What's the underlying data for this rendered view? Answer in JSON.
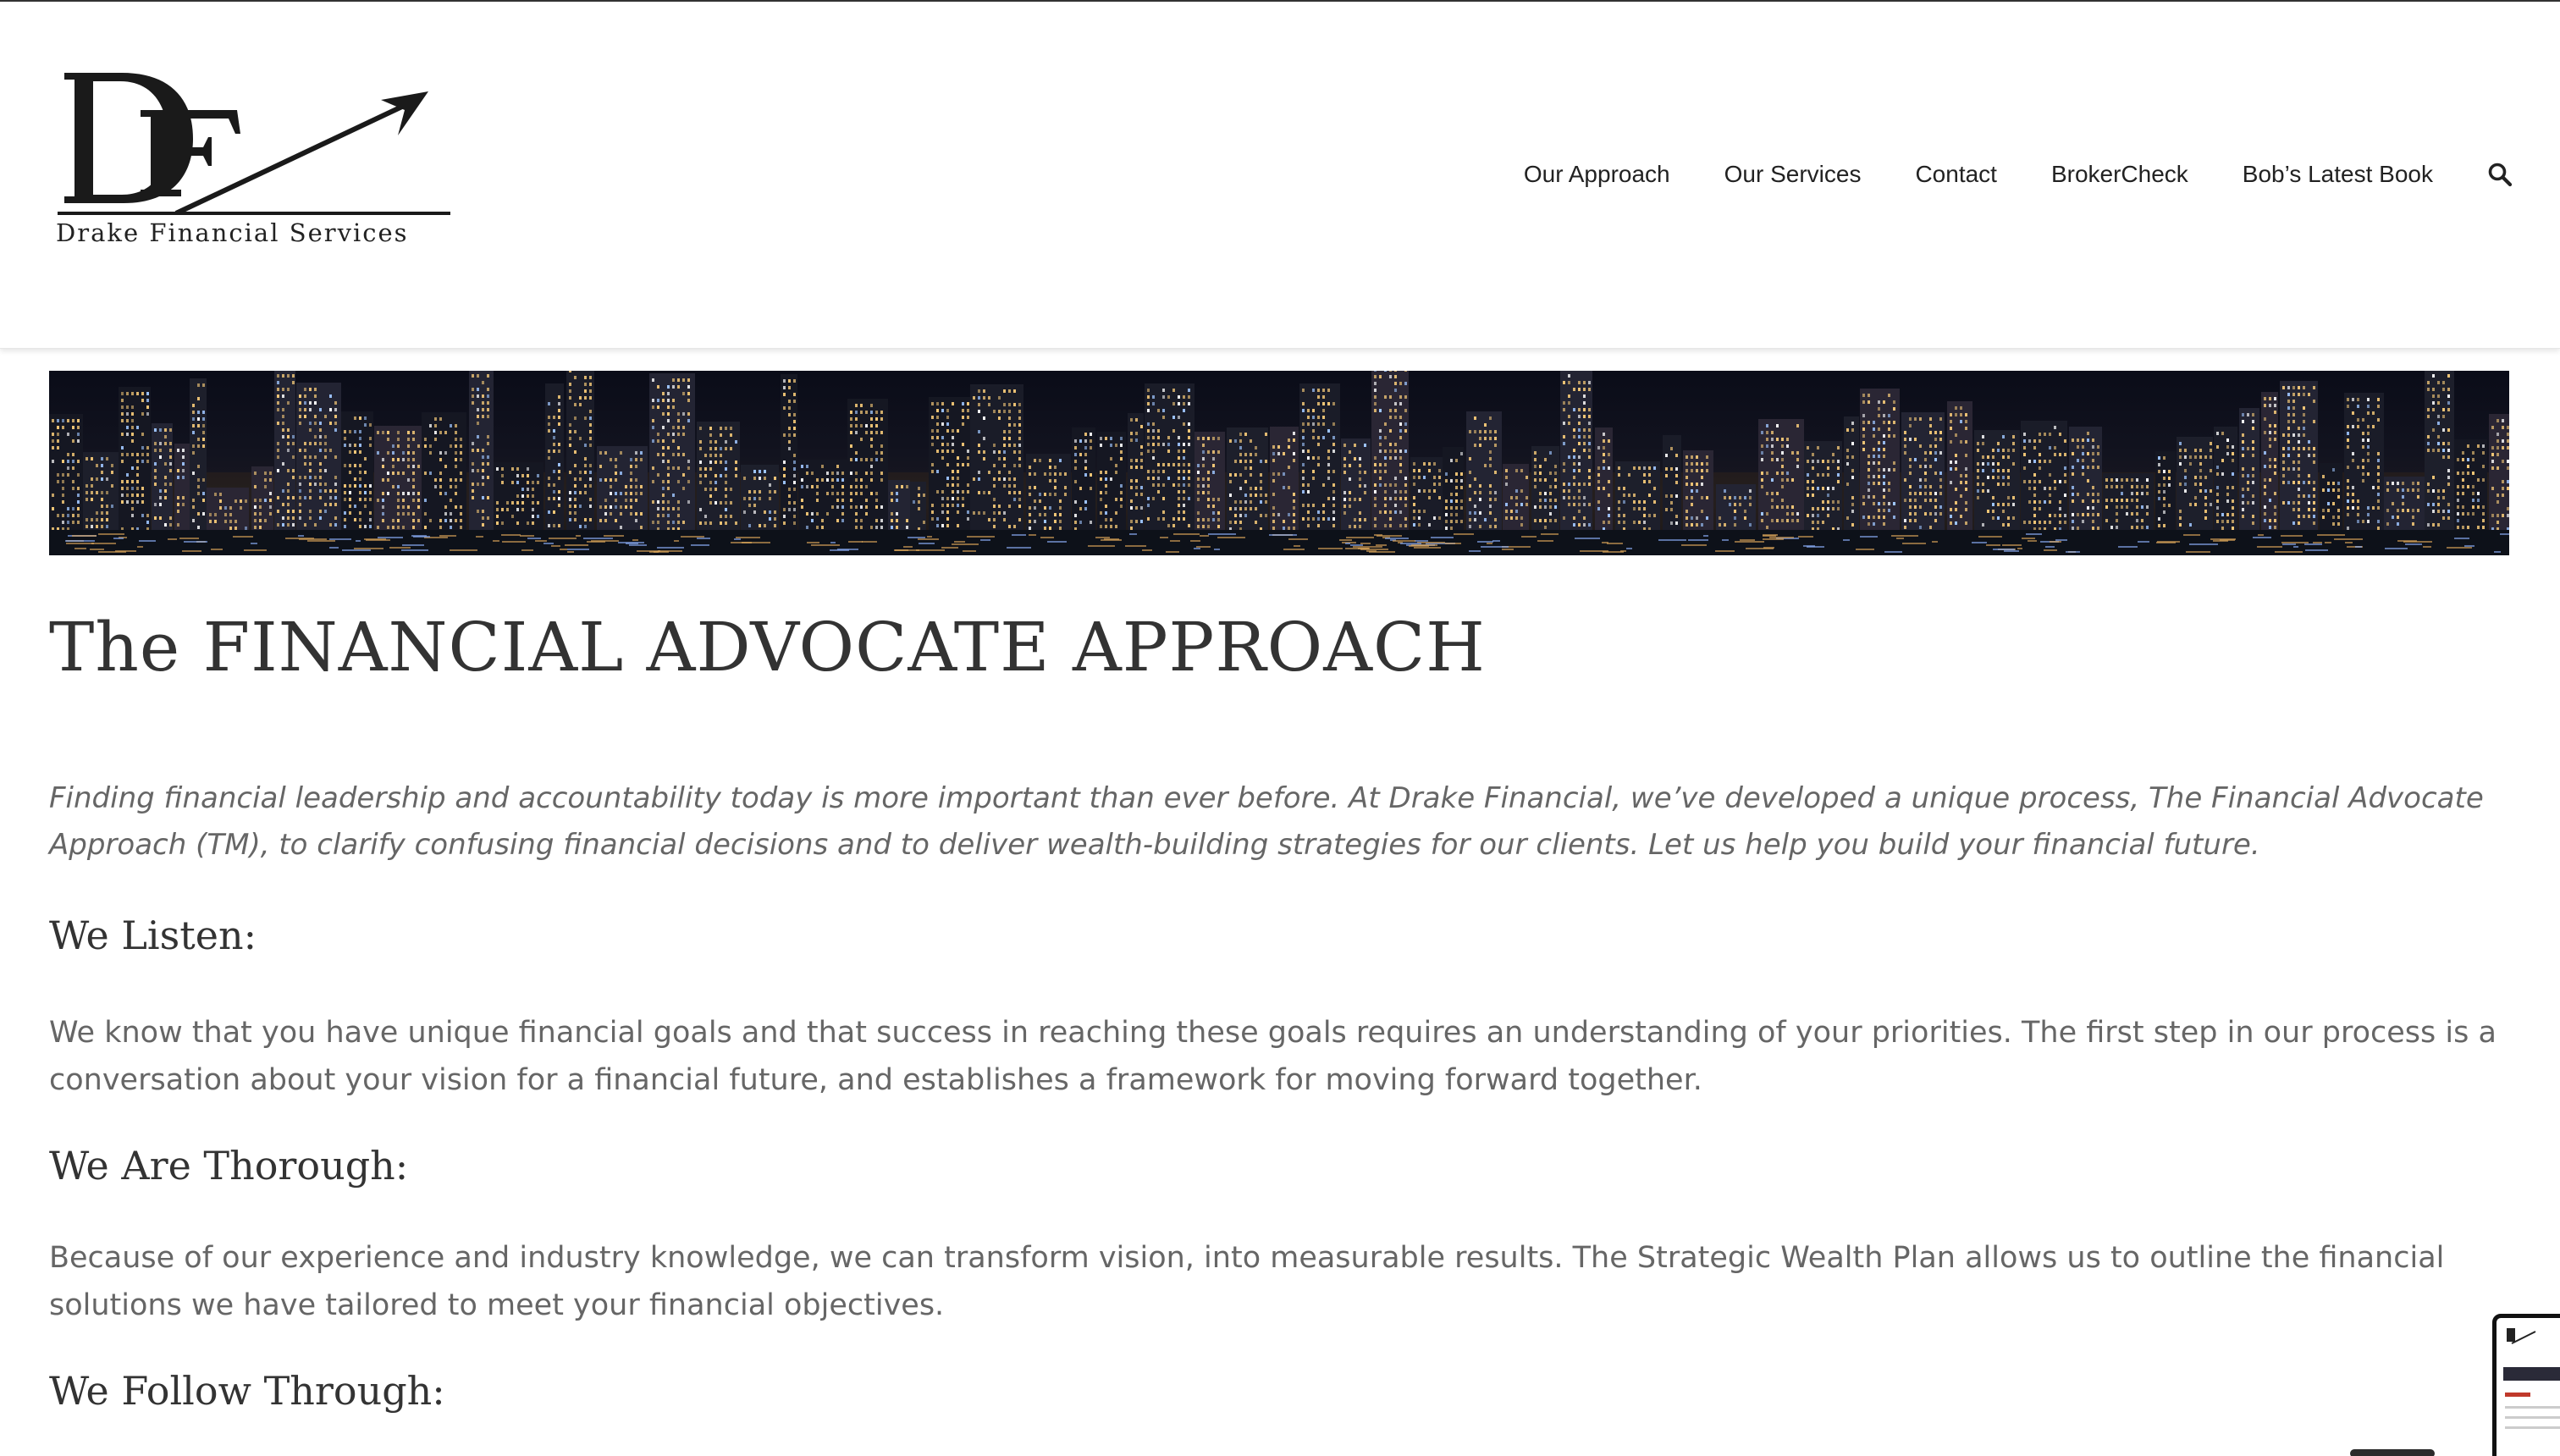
{
  "brand": {
    "monogram": "DF",
    "name": "Drake Financial Services"
  },
  "nav": {
    "items": [
      {
        "label": "Our Approach"
      },
      {
        "label": "Our Services"
      },
      {
        "label": "Contact"
      },
      {
        "label": "BrokerCheck"
      },
      {
        "label": "Bob’s Latest Book"
      }
    ],
    "search_icon": "search-icon"
  },
  "banner": {
    "icon": "city-skyline-image"
  },
  "page": {
    "title": "The FINANCIAL ADVOCATE APPROACH",
    "intro": "Finding financial leadership and accountability today is more important than ever before. At Drake Financial, we’ve developed a unique process, The Financial Advocate Approach (TM), to clarify confusing financial decisions and to deliver wealth-building strategies for our clients. Let us help you build your financial future.",
    "sections": [
      {
        "heading": "We Listen:",
        "body": "We know that you have unique financial goals and that success in reaching these goals requires an understanding of your priorities. The first step in our process is a conversation about your vision for a financial future, and establishes a framework for moving forward together."
      },
      {
        "heading": "We Are Thorough:",
        "body": "Because of our experience and industry knowledge, we can transform vision, into measurable results. The Strategic Wealth Plan allows us to outline the financial solutions we have tailored to meet your financial objectives."
      },
      {
        "heading": "We Follow Through:"
      }
    ]
  },
  "colors": {
    "text_dark": "#333333",
    "text_body": "#666666",
    "accent_red": "#c0392b"
  }
}
